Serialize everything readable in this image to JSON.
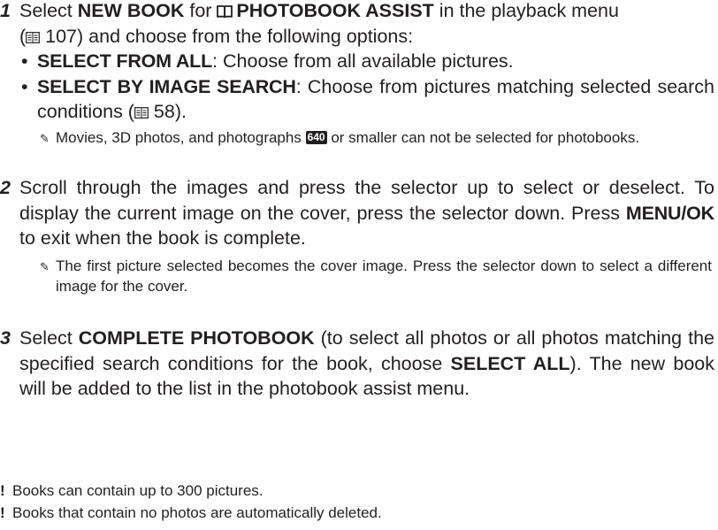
{
  "step1": {
    "number": "1",
    "p1": "Select ",
    "new_book": "NEW BOOK",
    "p2": " for ",
    "book_icon": "📖",
    "photobook_assist": "PHOTOBOOK ASSIST",
    "p3": " in the playback menu",
    "p4_prefix": "(",
    "ref_icon": "▤",
    "page_ref": " 107",
    "p4_suffix": ") and choose from the following options:",
    "options": [
      {
        "label": "SELECT FROM ALL",
        "text": ": Choose from all available pictures."
      },
      {
        "label": "SELECT BY IMAGE SEARCH",
        "text": ": Choose from pictures matching selected search conditions (",
        "page_ref": " 58",
        "end": ")."
      }
    ],
    "note": "Movies, 3D photos, and photographs",
    "note_badge": "640",
    "note_end": "or smaller can not be selected for photobooks."
  },
  "step2": {
    "number": "2",
    "text": "Scroll through the images and press the selector up to select or deselect. To display the current image on the cover, press the selector down.  Press ",
    "menu_ok": "MENU/OK",
    "text_end": " to exit when the book is complete.",
    "note": "The first picture selected becomes the cover image.  Press the selector down to select a different image for the cover."
  },
  "step3": {
    "number": "3",
    "p1": "Select ",
    "complete": "COMPLETE PHOTOBOOK",
    "p2": " (to select all photos or all photos matching the specified search conditions for the book, choose ",
    "select_all": "SELECT ALL",
    "p3": "). The new book will be added to the list in the photobook assist menu."
  },
  "cautions": [
    "Books can contain up to 300 pictures.",
    "Books that contain no photos are automatically deleted."
  ],
  "icons": {
    "note": "note-pencil-icon",
    "caution": "caution-icon",
    "book": "photobook-icon",
    "page_ref": "page-ref-icon"
  },
  "colors": {
    "text": "#231f20",
    "badge_bg": "#231f20"
  }
}
